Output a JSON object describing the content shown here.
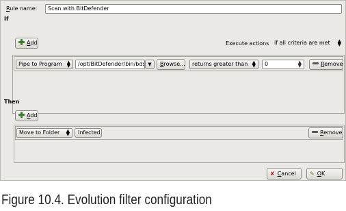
{
  "rule": {
    "name_label_u": "R",
    "name_label_rest": "ule name:",
    "name_value": "Scan with BitDefender"
  },
  "if_section": {
    "heading": "If",
    "add_label_u": "A",
    "add_label_rest": "dd",
    "execute_label": "Execute actions",
    "execute_select": "if all criteria are met",
    "criteria": [
      {
        "type": "Pipe to Program",
        "program_path": "/opt/BitDefender/bin/bds",
        "browse_label_u": "B",
        "browse_label_rest": "rowse...",
        "comparison": "returns greater than",
        "value": "0",
        "remove_label_u": "R",
        "remove_label_rest": "emove"
      }
    ]
  },
  "then_section": {
    "heading": "Then",
    "add_label_u": "A",
    "add_label_rest": "dd",
    "actions": [
      {
        "type": "Move to Folder",
        "folder": "Infected",
        "remove_label_u": "R",
        "remove_label_rest": "emove"
      }
    ]
  },
  "buttons": {
    "cancel_u": "C",
    "cancel_rest": "ancel",
    "ok_u": "O",
    "ok_rest": "K"
  },
  "caption": "Figure 10.4. Evolution filter configuration",
  "icons": {
    "add": "plus-icon",
    "remove": "minus-icon",
    "cancel": "cancel-icon",
    "ok": "ok-icon"
  },
  "colors": {
    "dialog_bg": "#ebe9e6",
    "add_icon": "#3a7d2a",
    "cancel_icon": "#c02020"
  }
}
